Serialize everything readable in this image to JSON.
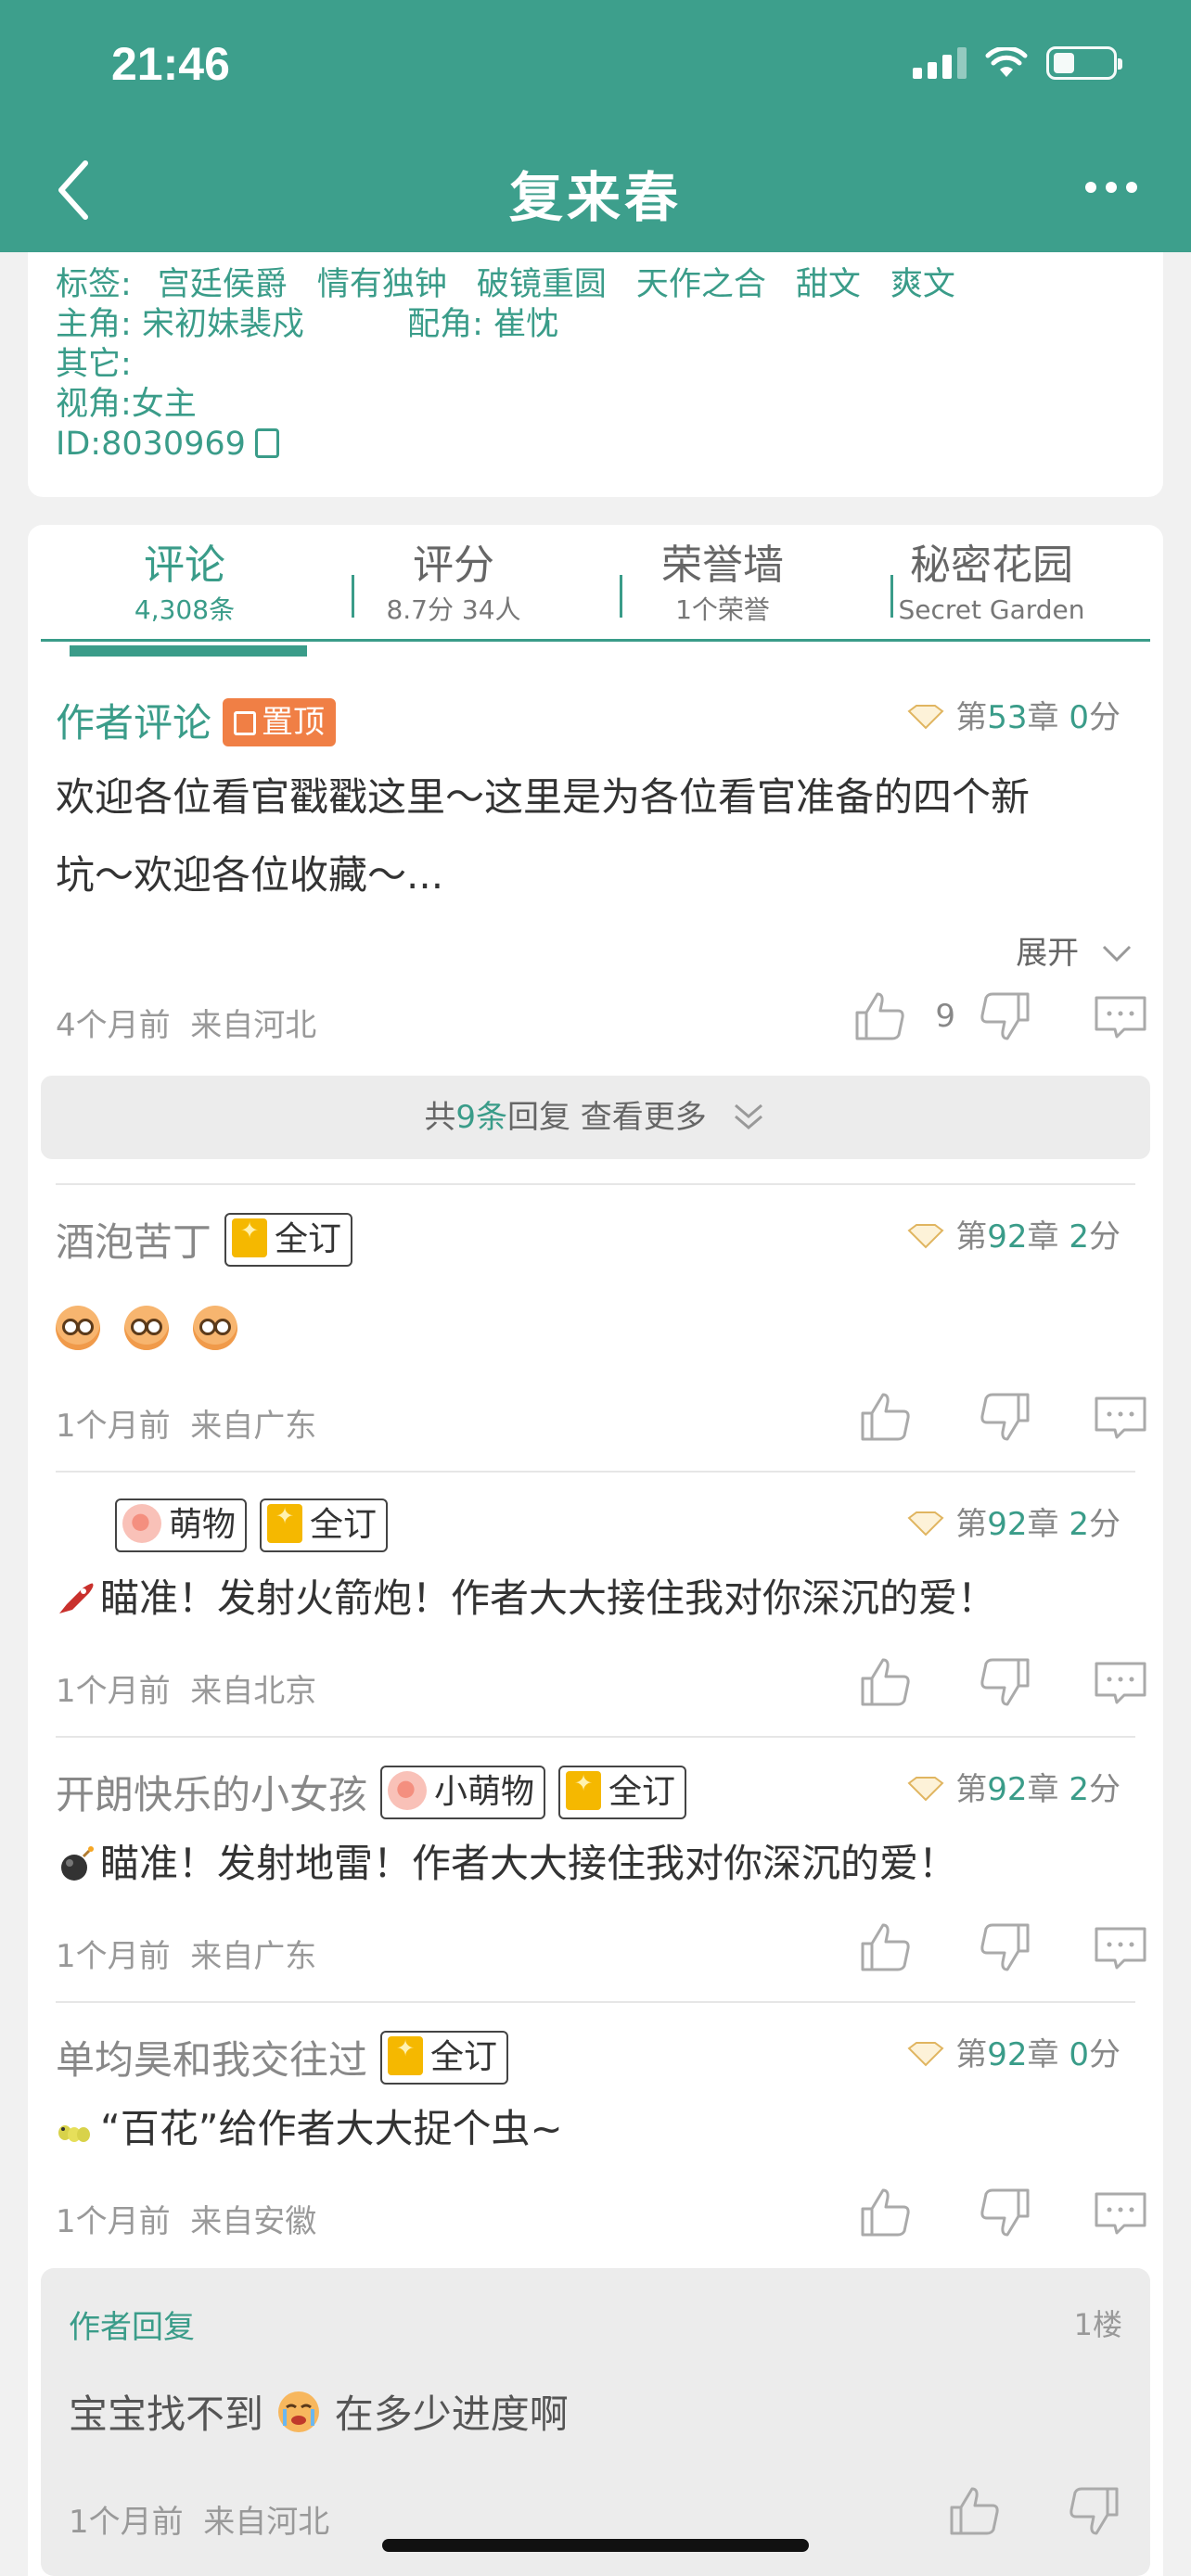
{
  "status_bar": {
    "time": "21:46"
  },
  "header": {
    "title": "复来春"
  },
  "info": {
    "tags_label": "标签:",
    "tags": [
      "宫廷侯爵",
      "情有独钟",
      "破镜重圆",
      "天作之合",
      "甜文",
      "爽文"
    ],
    "lead_label": "主角:",
    "lead_value": "宋初妹裴戍",
    "support_label": "配角:",
    "support_value": "崔忱",
    "other_label": "其它:",
    "pov": "视角:女主",
    "id": "ID:8030969"
  },
  "tabs": [
    {
      "label": "评论",
      "sub": "4,308条"
    },
    {
      "label": "评分",
      "sub": "8.7分 34人"
    },
    {
      "label": "荣誉墙",
      "sub": "1个荣誉"
    },
    {
      "label": "秘密花园",
      "sub": "Secret Garden"
    }
  ],
  "pinned": {
    "author": "作者评论",
    "pin_label": "置顶",
    "chapter": {
      "prefix": "第",
      "num": "53",
      "mid": "章",
      "score": "0",
      "suffix": "分"
    },
    "text_line1": "欢迎各位看官戳戳这里～这里是为各位看官准备的四个新",
    "text_line2": "坑～欢迎各位收藏～...",
    "expand_label": "展开",
    "time": "4个月前",
    "from": "来自河北",
    "likes": "9"
  },
  "more_replies": {
    "pre": "共",
    "count": "9条",
    "post": "回复 查看更多"
  },
  "comments": [
    {
      "user": "酒泡苦丁",
      "badge1": "全订",
      "badge2": "",
      "chapter_num": "92",
      "score": "2",
      "text": "",
      "time": "1个月前",
      "from": "来自广东"
    },
    {
      "user": "",
      "badge1": "萌物",
      "badge2": "全订",
      "chapter_num": "92",
      "score": "2",
      "text": "瞄准！发射火箭炮！作者大大接住我对你深沉的爱！",
      "time": "1个月前",
      "from": "来自北京"
    },
    {
      "user": "开朗快乐的小女孩",
      "badge1": "小萌物",
      "badge2": "全订",
      "chapter_num": "92",
      "score": "2",
      "text": "瞄准！发射地雷！作者大大接住我对你深沉的爱！",
      "time": "1个月前",
      "from": "来自广东"
    },
    {
      "user": "单均昊和我交往过",
      "badge1": "全订",
      "badge2": "",
      "chapter_num": "92",
      "score": "0",
      "text": "“百花”给作者大大捉个虫~",
      "time": "1个月前",
      "from": "来自安徽"
    }
  ],
  "chapter_text": {
    "prefix": "第",
    "mid": "章",
    "suffix": "分"
  },
  "author_reply": {
    "label": "作者回复",
    "floor": "1楼",
    "text_before": "宝宝找不到",
    "text_after": "在多少进度啊",
    "time": "1个月前",
    "from": "来自河北"
  },
  "colors": {
    "brand": "#3d9f8c",
    "pin": "#f07f45",
    "badge_gold": "#f5b800"
  }
}
